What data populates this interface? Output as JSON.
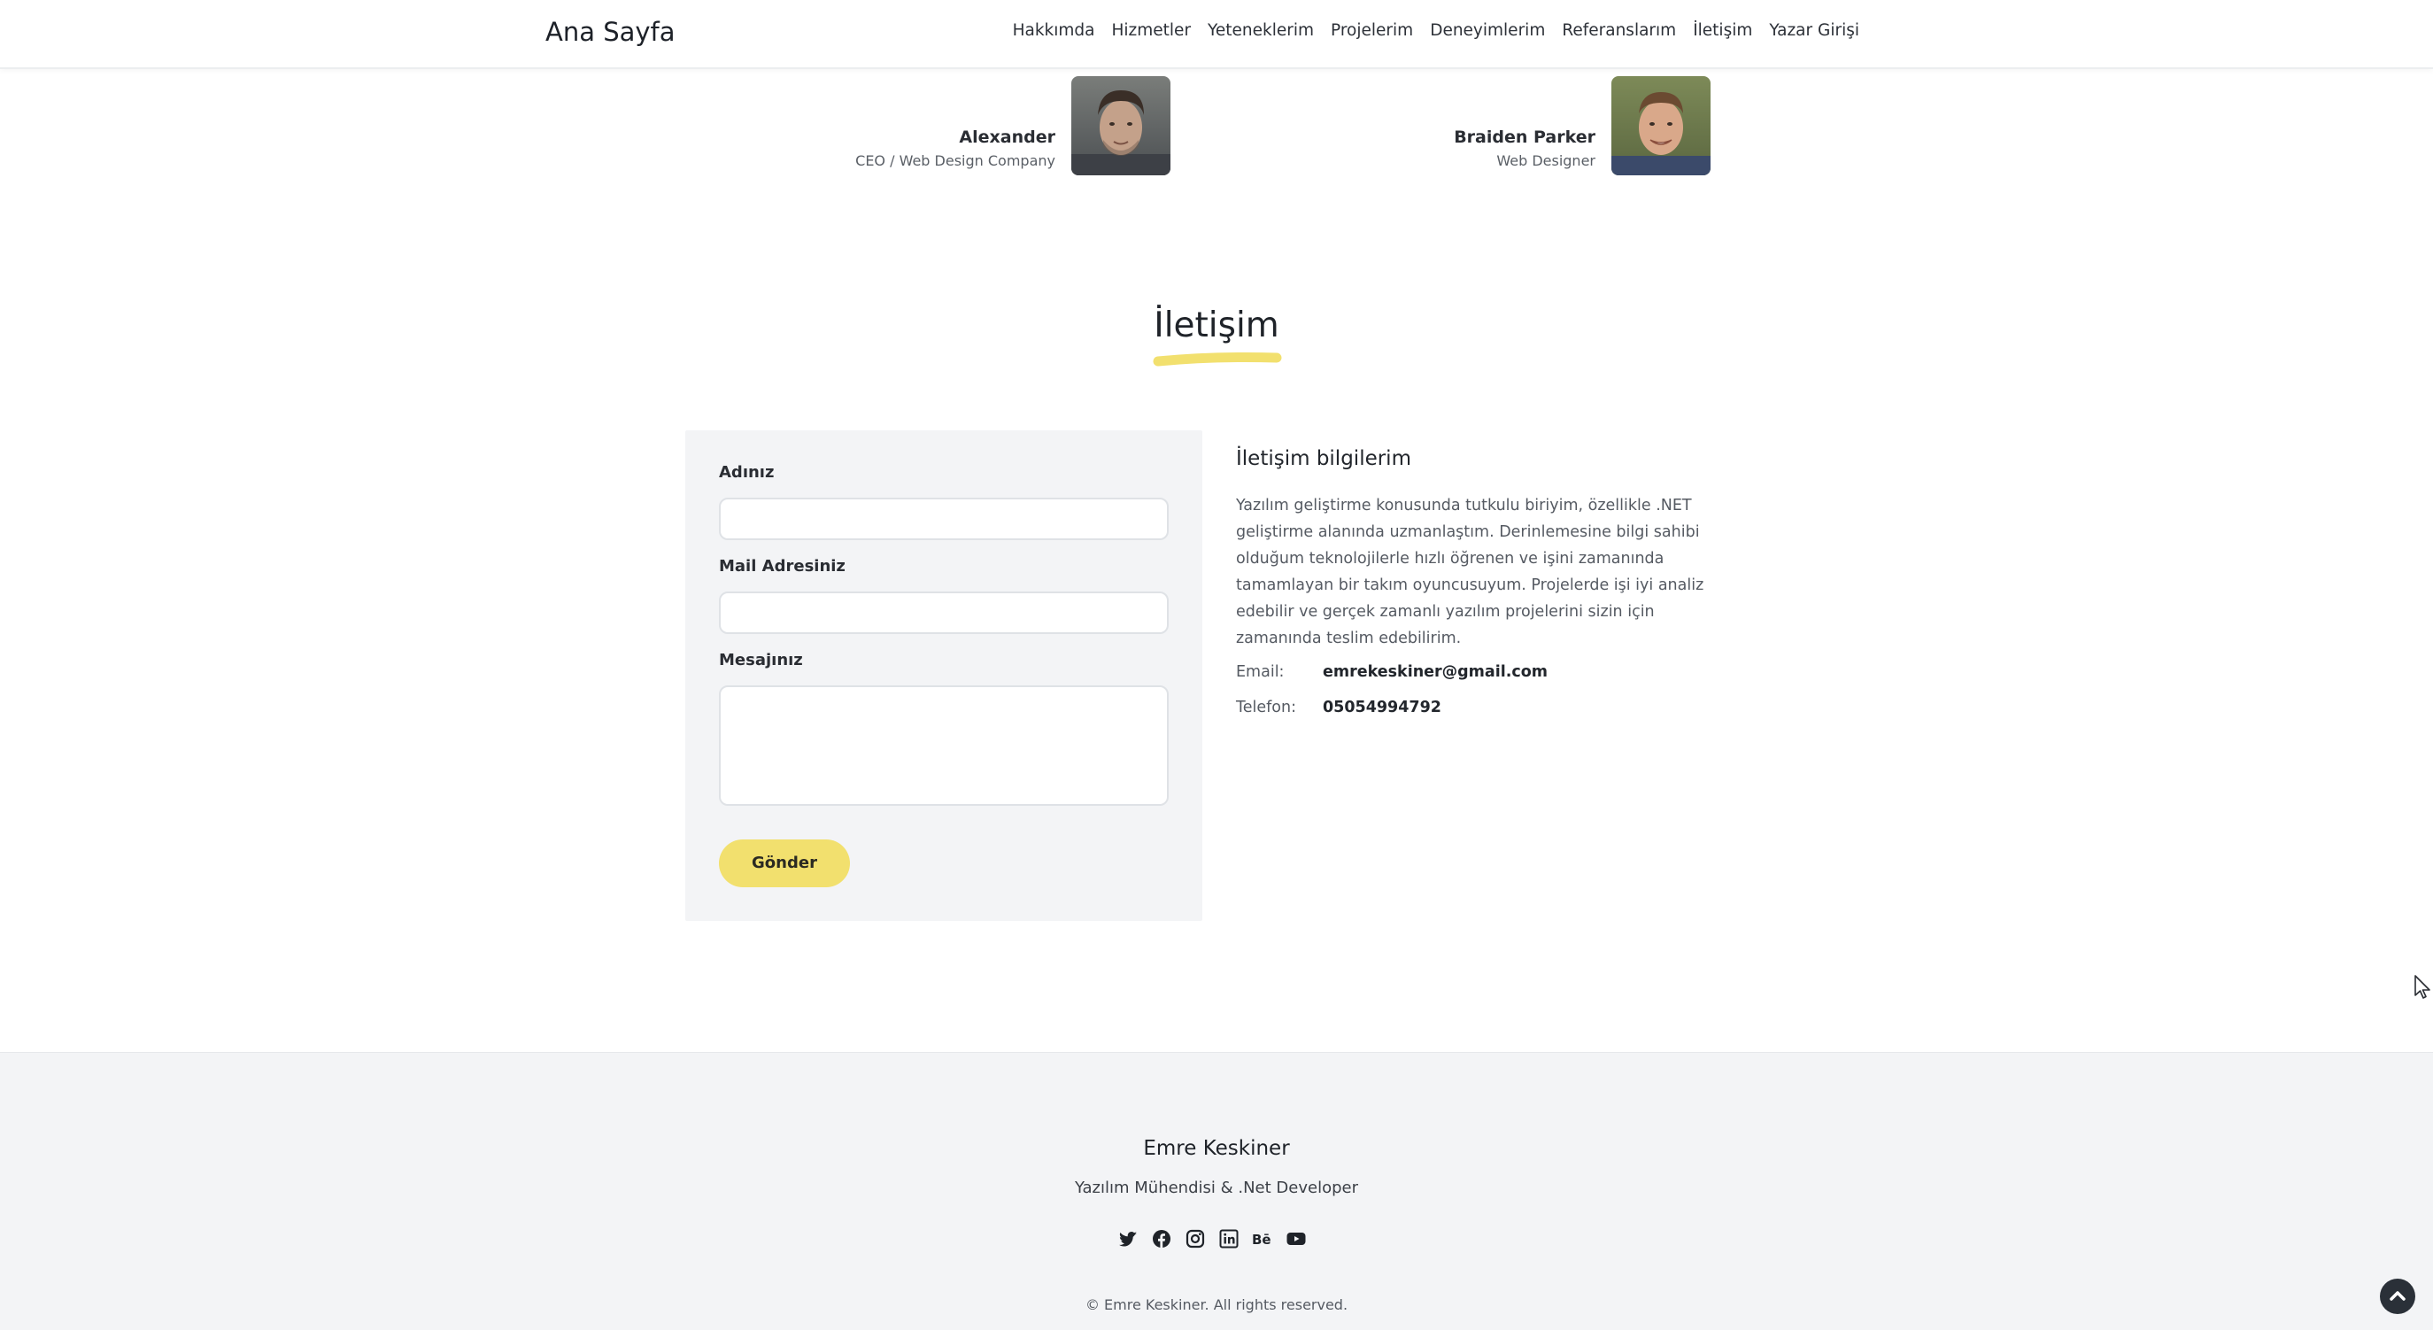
{
  "nav": {
    "brand": "Ana Sayfa",
    "items": [
      "Hakkımda",
      "Hizmetler",
      "Yeteneklerim",
      "Projelerim",
      "Deneyimlerim",
      "Referanslarım",
      "İletişim",
      "Yazar Girişi"
    ]
  },
  "testimonials": [
    {
      "name": "Alexander",
      "role": "CEO / Web Design Company"
    },
    {
      "name": "Braiden Parker",
      "role": "Web Designer"
    }
  ],
  "contact": {
    "title": "İletişim",
    "form": {
      "name_label": "Adınız",
      "email_label": "Mail Adresiniz",
      "message_label": "Mesajınız",
      "name_value": "",
      "email_value": "",
      "message_value": "",
      "submit_label": "Gönder"
    },
    "info": {
      "heading": "İletişim bilgilerim",
      "text": "Yazılım geliştirme konusunda tutkulu biriyim, özellikle .NET geliştirme alanında uzmanlaştım. Derinlemesine bilgi sahibi olduğum teknolojilerle hızlı öğrenen ve işini zamanında tamamlayan bir takım oyuncusuyum. Projelerde işi iyi analiz edebilir ve gerçek zamanlı yazılım projelerini sizin için zamanında teslim edebilirim.",
      "email_label": "Email:",
      "email_value": "emrekeskiner@gmail.com",
      "phone_label": "Telefon:",
      "phone_value": "05054994792"
    }
  },
  "footer": {
    "name": "Emre Keskiner",
    "subtitle": "Yazılım Mühendisi & .Net Developer",
    "socials": [
      "twitter-icon",
      "facebook-icon",
      "instagram-icon",
      "linkedin-icon",
      "behance-icon",
      "youtube-icon"
    ],
    "copyright": "© Emre Keskiner. All rights reserved."
  },
  "colors": {
    "accent": "#f2e06e",
    "footer_bg": "#f3f4f6",
    "form_bg": "#f3f4f6"
  }
}
